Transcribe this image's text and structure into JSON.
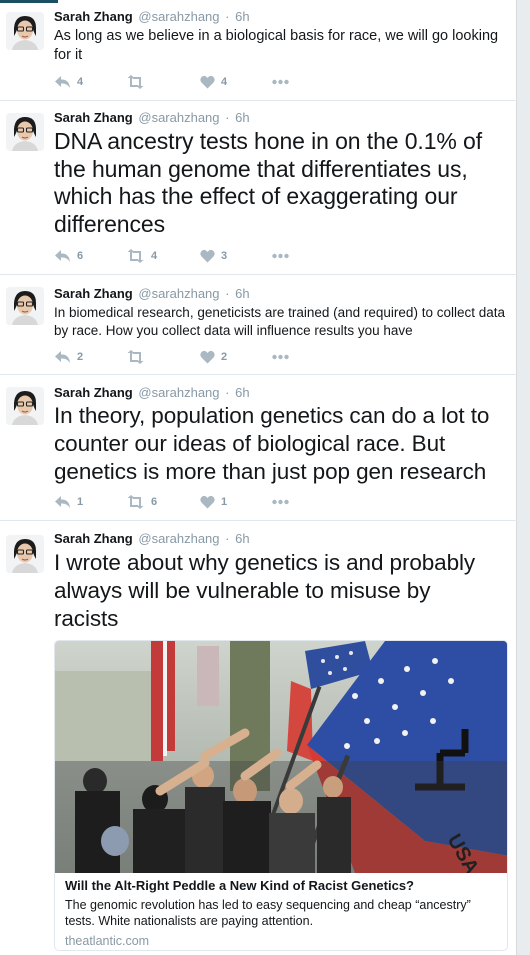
{
  "colors": {
    "text": "#14171a",
    "muted": "#8899a6",
    "icon": "#aab8c2",
    "divider": "#e1e8ed"
  },
  "author": {
    "name": "Sarah Zhang",
    "handle": "@sarahzhang",
    "separator": "·"
  },
  "tweets": [
    {
      "time": "6h",
      "text": "As long as we believe in a biological basis for race, we will go looking for it",
      "reply_count": "4",
      "retweet_count": "",
      "like_count": "4"
    },
    {
      "time": "6h",
      "text": "DNA ancestry tests hone in on the 0.1% of the human genome that differentiates us, which has the effect of exaggerating our differences",
      "reply_count": "6",
      "retweet_count": "4",
      "like_count": "3"
    },
    {
      "time": "6h",
      "text": "In biomedical research, geneticists are trained (and required) to collect data by race. How you collect data will influence results you have",
      "reply_count": "2",
      "retweet_count": "",
      "like_count": "2"
    },
    {
      "time": "6h",
      "text": "In theory, population genetics can do a lot to counter our ideas of biological race. But genetics is more than just pop gen research",
      "reply_count": "1",
      "retweet_count": "6",
      "like_count": "1"
    },
    {
      "time": "6h",
      "text": "I wrote about why genetics is and probably always will be vulnerable to misuse by racists",
      "card": {
        "title": "Will the Alt-Right Peddle a New Kind of Racist Genetics?",
        "description": "The genomic revolution has led to easy sequencing and cheap “ancestry” tests. White nationalists are paying attention.",
        "domain": "theatlantic.com",
        "image_flag_text": "USA"
      }
    }
  ]
}
